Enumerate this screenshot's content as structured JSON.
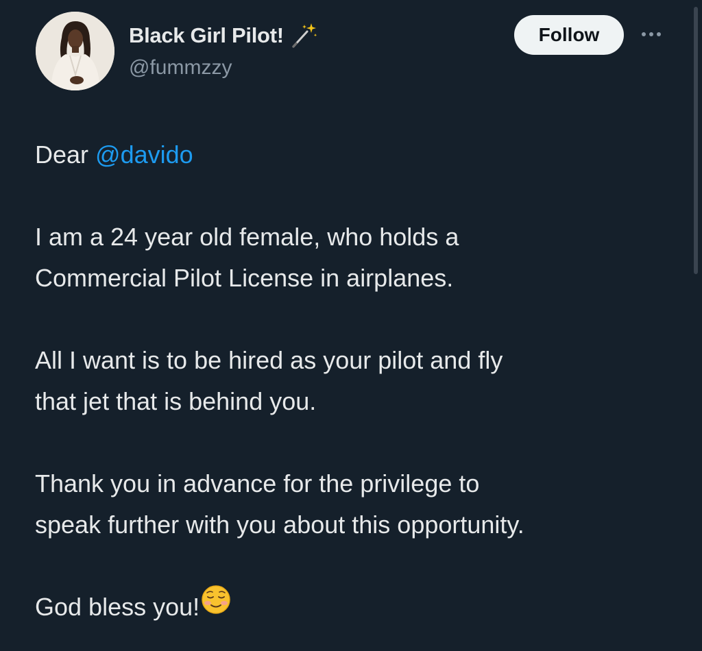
{
  "author": {
    "display_name": "Black Girl Pilot!",
    "handle": "@fummzzy",
    "name_icon": "magic-wand-icon",
    "avatar": "profile-photo"
  },
  "actions": {
    "follow_label": "Follow",
    "more_icon": "more-horizontal-icon"
  },
  "tweet": {
    "greeting_prefix": "Dear ",
    "mention": "@davido",
    "p1_line1": "I am a 24 year old female, who holds a",
    "p1_line2": "Commercial Pilot License in airplanes.",
    "p2_line1": "All I want is to be hired as your pilot and fly",
    "p2_line2": "that jet that is behind you.",
    "p3_line1": "Thank you in advance for the privilege to",
    "p3_line2": "speak further with you about this opportunity.",
    "closing": "God bless you!",
    "closing_icon": "smiling-face-emoji"
  },
  "colors": {
    "background": "#15202b",
    "text": "#e7e9ea",
    "secondary": "#8b98a5",
    "link": "#1d9bf0",
    "follow_bg": "#eff3f4"
  }
}
